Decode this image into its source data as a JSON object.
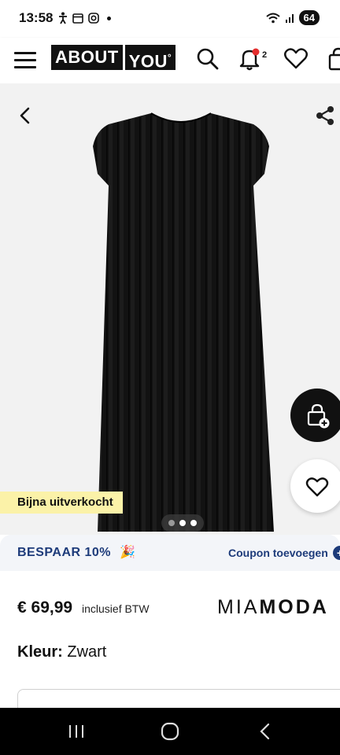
{
  "status_bar": {
    "time": "13:58",
    "battery": "64"
  },
  "header": {
    "logo_left": "ABOUT",
    "logo_right": "YOU",
    "logo_mark": "°",
    "notification_count": "2",
    "icons": [
      "menu-icon",
      "search-icon",
      "bell-icon",
      "heart-icon",
      "bag-icon"
    ]
  },
  "gallery": {
    "badge": "Bijna uitverkocht",
    "image_count": 3,
    "active_index": 0
  },
  "coupon": {
    "label": "BESPAAR 10%",
    "emoji": "🎉",
    "action": "Coupon toevoegen"
  },
  "product": {
    "price": "€ 69,99",
    "vat_note": "inclusief BTW",
    "brand_part1": "MIA",
    "brand_part2": "MODA",
    "color_label": "Kleur:",
    "color_value": "Zwart"
  },
  "colors": {
    "coupon_text": "#1d3b7a",
    "badge_bg": "#fbf2a8",
    "gallery_bg": "#f2f2f2"
  }
}
